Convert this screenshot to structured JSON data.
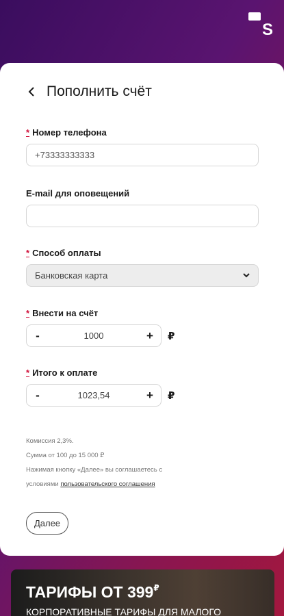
{
  "logo": {
    "letter": "S"
  },
  "header": {
    "title": "Пополнить счёт"
  },
  "form": {
    "required_mark": "*",
    "phone": {
      "label": "Номер телефона",
      "value": "+73333333333"
    },
    "email": {
      "label": "E-mail для оповещений",
      "value": ""
    },
    "payment_method": {
      "label": "Способ оплаты",
      "selected": "Банковская карта"
    },
    "deposit": {
      "label": "Внести на счёт",
      "minus": "-",
      "value": "1000",
      "plus": "+",
      "currency": "₽"
    },
    "total": {
      "label": "Итого к оплате",
      "minus": "-",
      "value": "1023,54",
      "plus": "+",
      "currency": "₽"
    }
  },
  "notes": {
    "commission": "Комиссия 2,3%.",
    "range": "Сумма от 100 до 15 000 ₽",
    "agreement_prefix": "Нажимая кнопку «Далее» вы соглашаетесь с",
    "agreement_prefix2": "условиями",
    "agreement_link": "пользовательского соглашения"
  },
  "next_button": "Далее",
  "banner": {
    "title": "ТАРИФЫ ОТ 399",
    "title_currency": "₽",
    "subtitle": "КОРПОРАТИВНЫЕ ТАРИФЫ ДЛЯ МАЛОГО"
  }
}
